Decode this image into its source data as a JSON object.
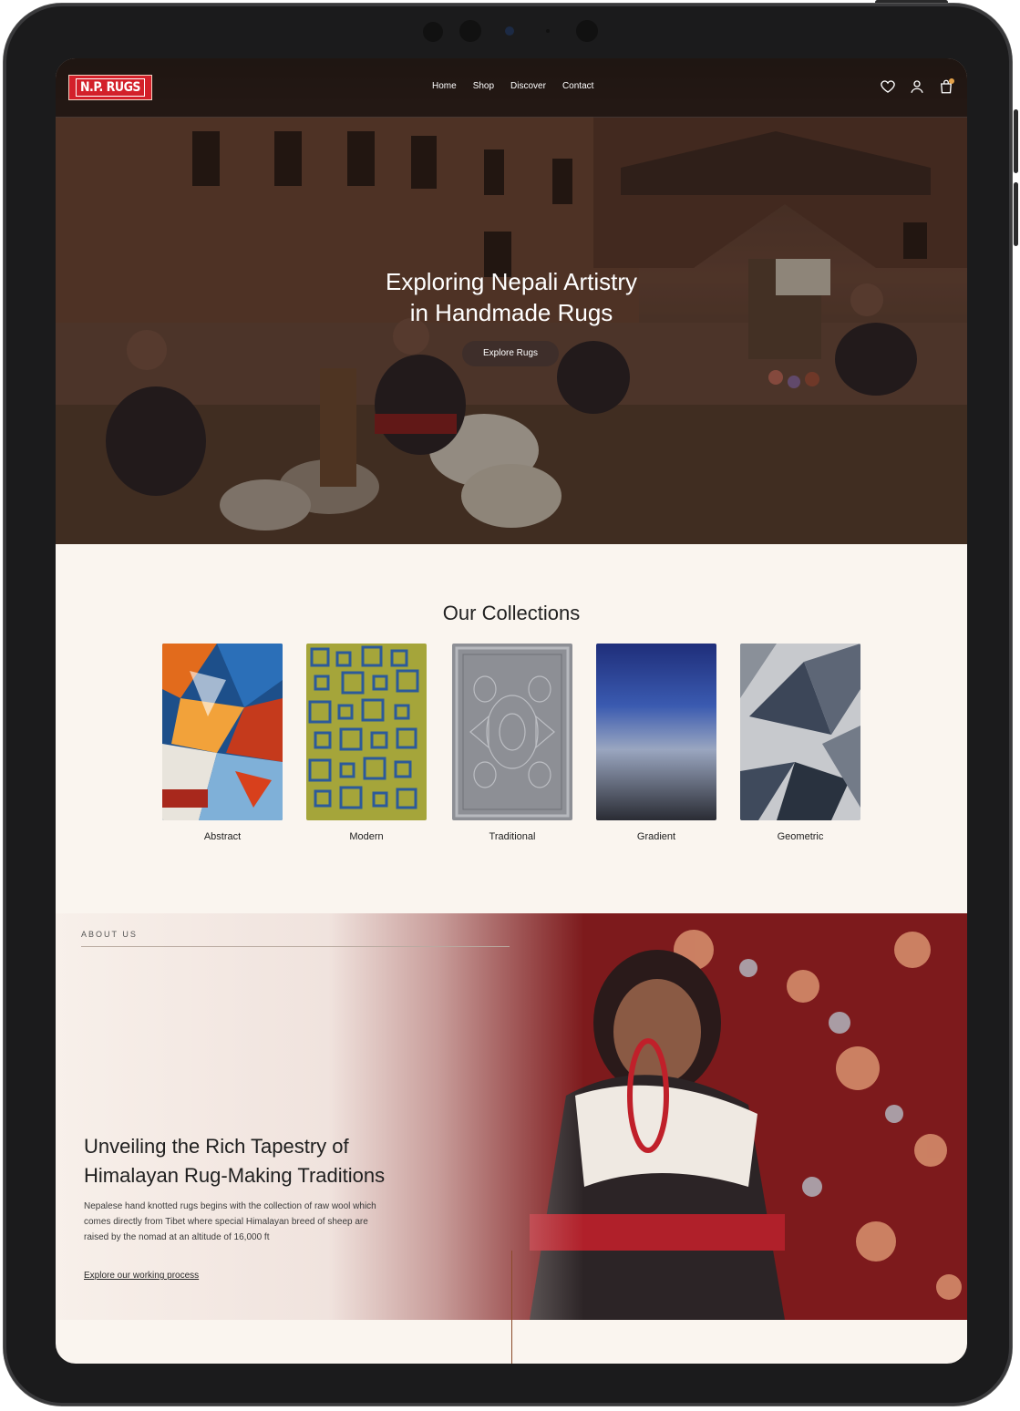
{
  "brand": {
    "logo_text": "N.P. RUGS"
  },
  "nav": {
    "links": [
      "Home",
      "Shop",
      "Discover",
      "Contact"
    ],
    "icons": [
      "heart-icon",
      "user-icon",
      "bag-icon"
    ]
  },
  "hero": {
    "title_line1": "Exploring Nepali Artistry",
    "title_line2": "in Handmade Rugs",
    "cta": "Explore Rugs"
  },
  "collections": {
    "title": "Our Collections",
    "items": [
      {
        "label": "Abstract"
      },
      {
        "label": "Modern"
      },
      {
        "label": "Traditional"
      },
      {
        "label": "Gradient"
      },
      {
        "label": "Geometric"
      }
    ]
  },
  "about": {
    "eyebrow": "ABOUT US",
    "title_line1": "Unveiling the Rich Tapestry of",
    "title_line2": "Himalayan Rug-Making Traditions",
    "text": "Nepalese hand knotted rugs begins with the collection of raw wool which comes directly from Tibet where special Himalayan breed of sheep are raised by the nomad at an altitude of 16,000 ft",
    "link": "Explore our working process"
  },
  "colors": {
    "accent_red": "#d3202a",
    "cream": "#faf5ef"
  }
}
